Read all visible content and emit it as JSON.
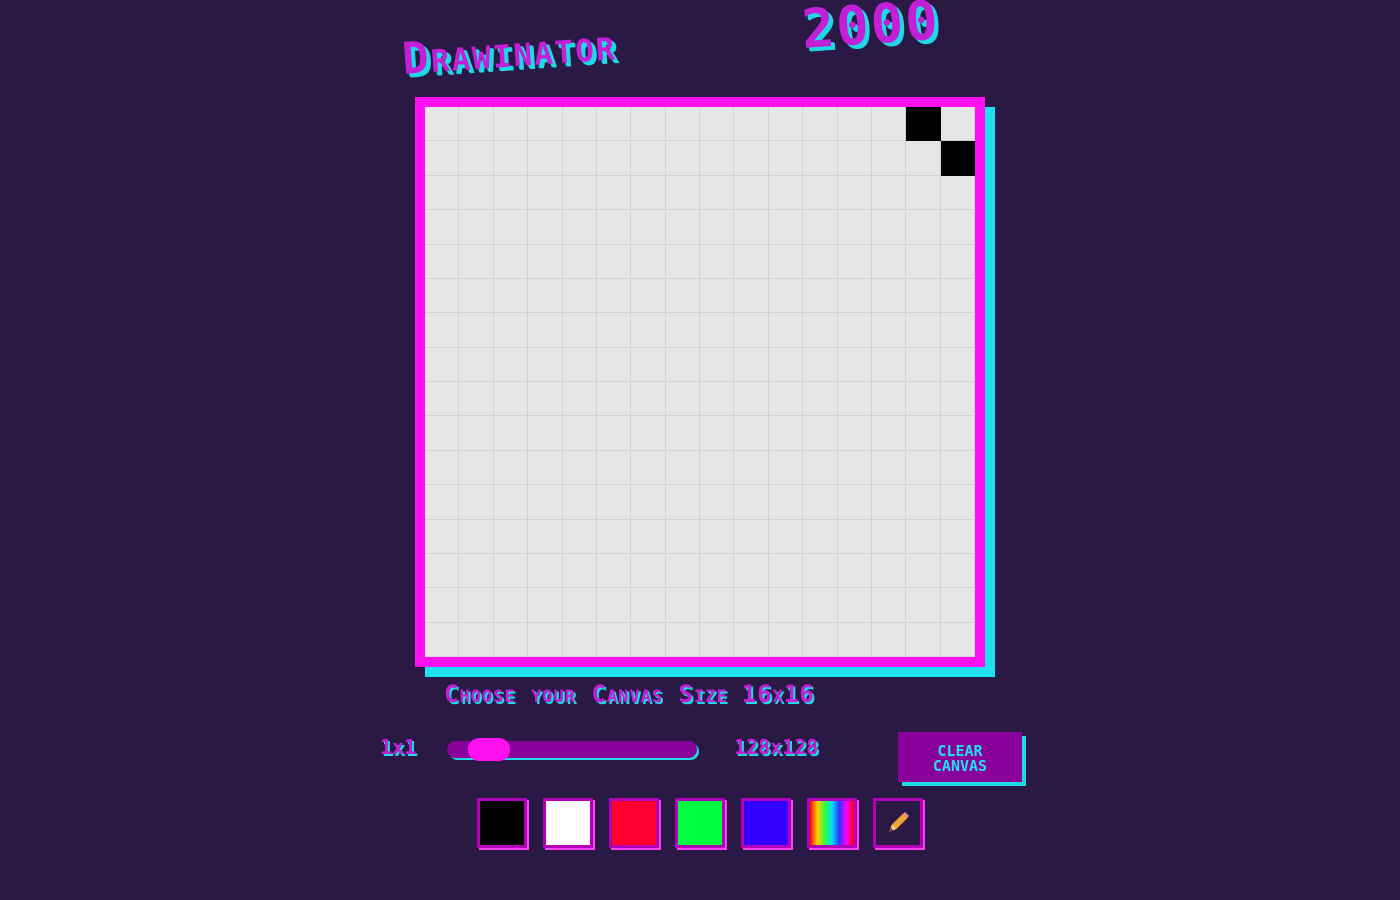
{
  "app": {
    "title_part1": "Drawinator",
    "title_part2": "2000"
  },
  "canvas": {
    "grid_size": 16,
    "filled_cells": [
      [
        0,
        14
      ],
      [
        1,
        15
      ]
    ],
    "cell_color": "#e6e6e6",
    "filled_color": "#000000",
    "frame_color": "#ff10f0",
    "shadow_color": "#1fe0ee"
  },
  "size_control": {
    "label": "Choose your Canvas Size",
    "current_value": "16x16",
    "min_label": "1x1",
    "max_label": "128x128",
    "slider_value": 16,
    "slider_min": 1,
    "slider_max": 128
  },
  "actions": {
    "clear_line1": "CLEAR",
    "clear_line2": "CANVAS"
  },
  "palette": [
    {
      "name": "black",
      "color": "#000000"
    },
    {
      "name": "white",
      "color": "#ffffff"
    },
    {
      "name": "red",
      "color": "#ff0030"
    },
    {
      "name": "green",
      "color": "#00ff40"
    },
    {
      "name": "blue",
      "color": "#3300ff"
    },
    {
      "name": "rainbow",
      "color": "rainbow"
    },
    {
      "name": "pencil",
      "icon": "pencil-icon"
    }
  ],
  "theme": {
    "background": "#2a1845",
    "accent_magenta": "#c21fd6",
    "accent_cyan": "#1fd8e6",
    "button_bg": "#8a009a"
  }
}
